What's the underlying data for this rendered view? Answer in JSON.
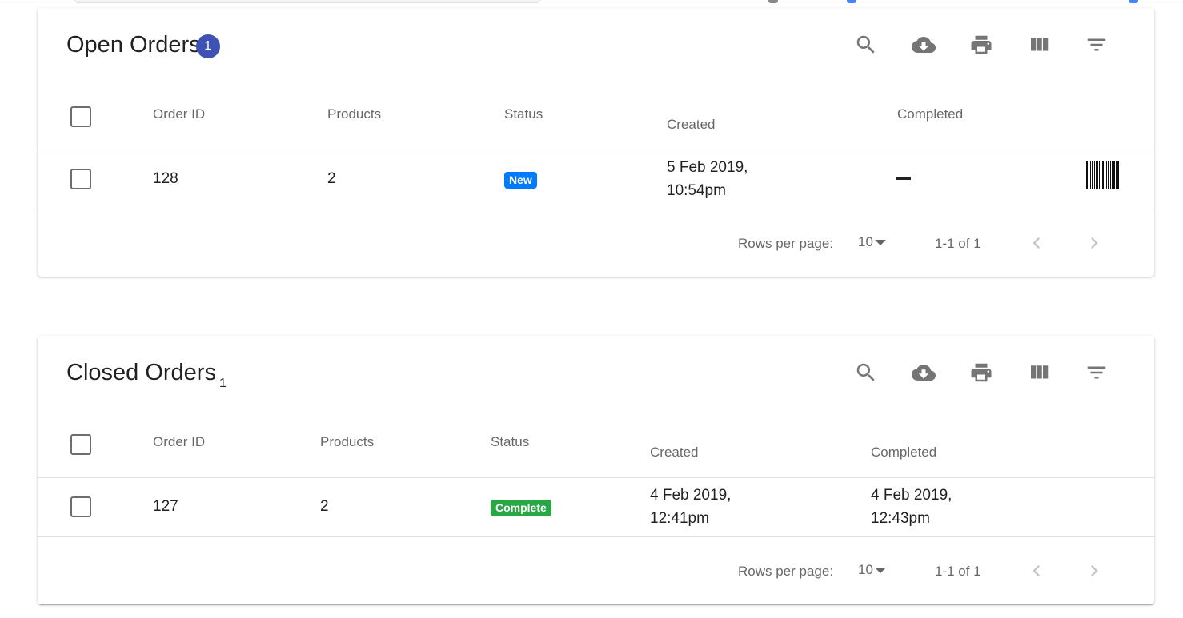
{
  "colors": {
    "accent": "#3f51b5",
    "status_new": "#007bff",
    "status_complete": "#28a745",
    "icon": "#757575"
  },
  "toolbar_icons": [
    "search-icon",
    "cloud-download-icon",
    "print-icon",
    "view-column-icon",
    "filter-list-icon"
  ],
  "open_orders": {
    "title": "Open Orders",
    "count": "1",
    "columns": [
      "Order ID",
      "Products",
      "Status",
      "Created",
      "Completed"
    ],
    "rows": [
      {
        "order_id": "128",
        "products": "2",
        "status": "New",
        "created_line1": "5 Feb 2019,",
        "created_line2": "10:54pm",
        "completed": "–"
      }
    ],
    "footer": {
      "rows_per_page_label": "Rows per page:",
      "rows_per_page_value": "10",
      "range": "1-1 of 1"
    }
  },
  "closed_orders": {
    "title": "Closed Orders",
    "count": "1",
    "columns": [
      "Order ID",
      "Products",
      "Status",
      "Created",
      "Completed"
    ],
    "rows": [
      {
        "order_id": "127",
        "products": "2",
        "status": "Complete",
        "created_line1": "4 Feb 2019,",
        "created_line2": "12:41pm",
        "completed_line1": "4 Feb 2019,",
        "completed_line2": "12:43pm"
      }
    ],
    "footer": {
      "rows_per_page_label": "Rows per page:",
      "rows_per_page_value": "10",
      "range": "1-1 of 1"
    }
  }
}
